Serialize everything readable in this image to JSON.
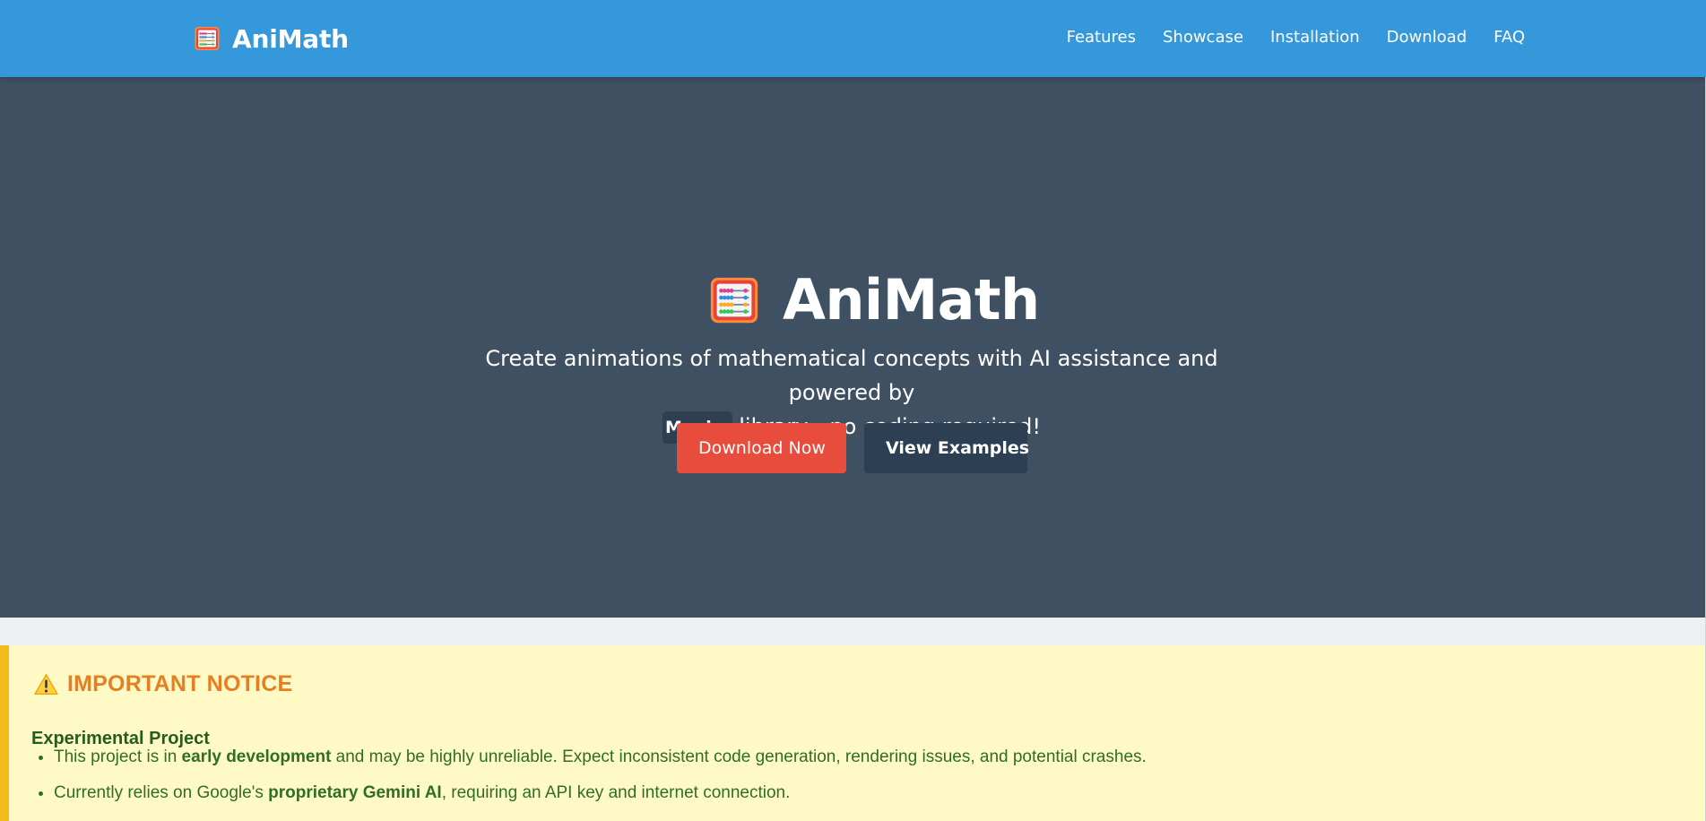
{
  "nav": {
    "brand": "AniMath",
    "links": [
      "Features",
      "Showcase",
      "Installation",
      "Download",
      "FAQ"
    ]
  },
  "hero": {
    "title": "AniMath",
    "subtitle": {
      "line1": "Create animations of mathematical concepts with AI assistance and powered by",
      "library": "Manim",
      "line2_suffix": " library - no coding required!"
    },
    "primary_button": "Download Now",
    "secondary_button": "View Examples"
  },
  "notice": {
    "heading": "IMPORTANT NOTICE",
    "subheading": "Experimental Project",
    "items": [
      {
        "before": "This project is in ",
        "strong": "early development",
        "after": " and may be highly unreliable. Expect inconsistent code generation, rendering issues, and potential crashes."
      },
      {
        "before": "Currently relies on Google's ",
        "strong": "proprietary Gemini AI",
        "after": ", requiring an API key and internet connection."
      }
    ]
  },
  "icons": {
    "brand": "abacus-icon",
    "hero": "abacus-icon",
    "notice": "warning-icon"
  },
  "colors": {
    "nav": "#3498db",
    "hero": "#3f5062",
    "primary_button": "#e74c3c",
    "secondary_button": "#2d3f52",
    "notice_background": "#fff9c6",
    "notice_border": "#f5bb1c",
    "notice_heading": "#e67e22",
    "notice_text": "#2f6f22"
  }
}
